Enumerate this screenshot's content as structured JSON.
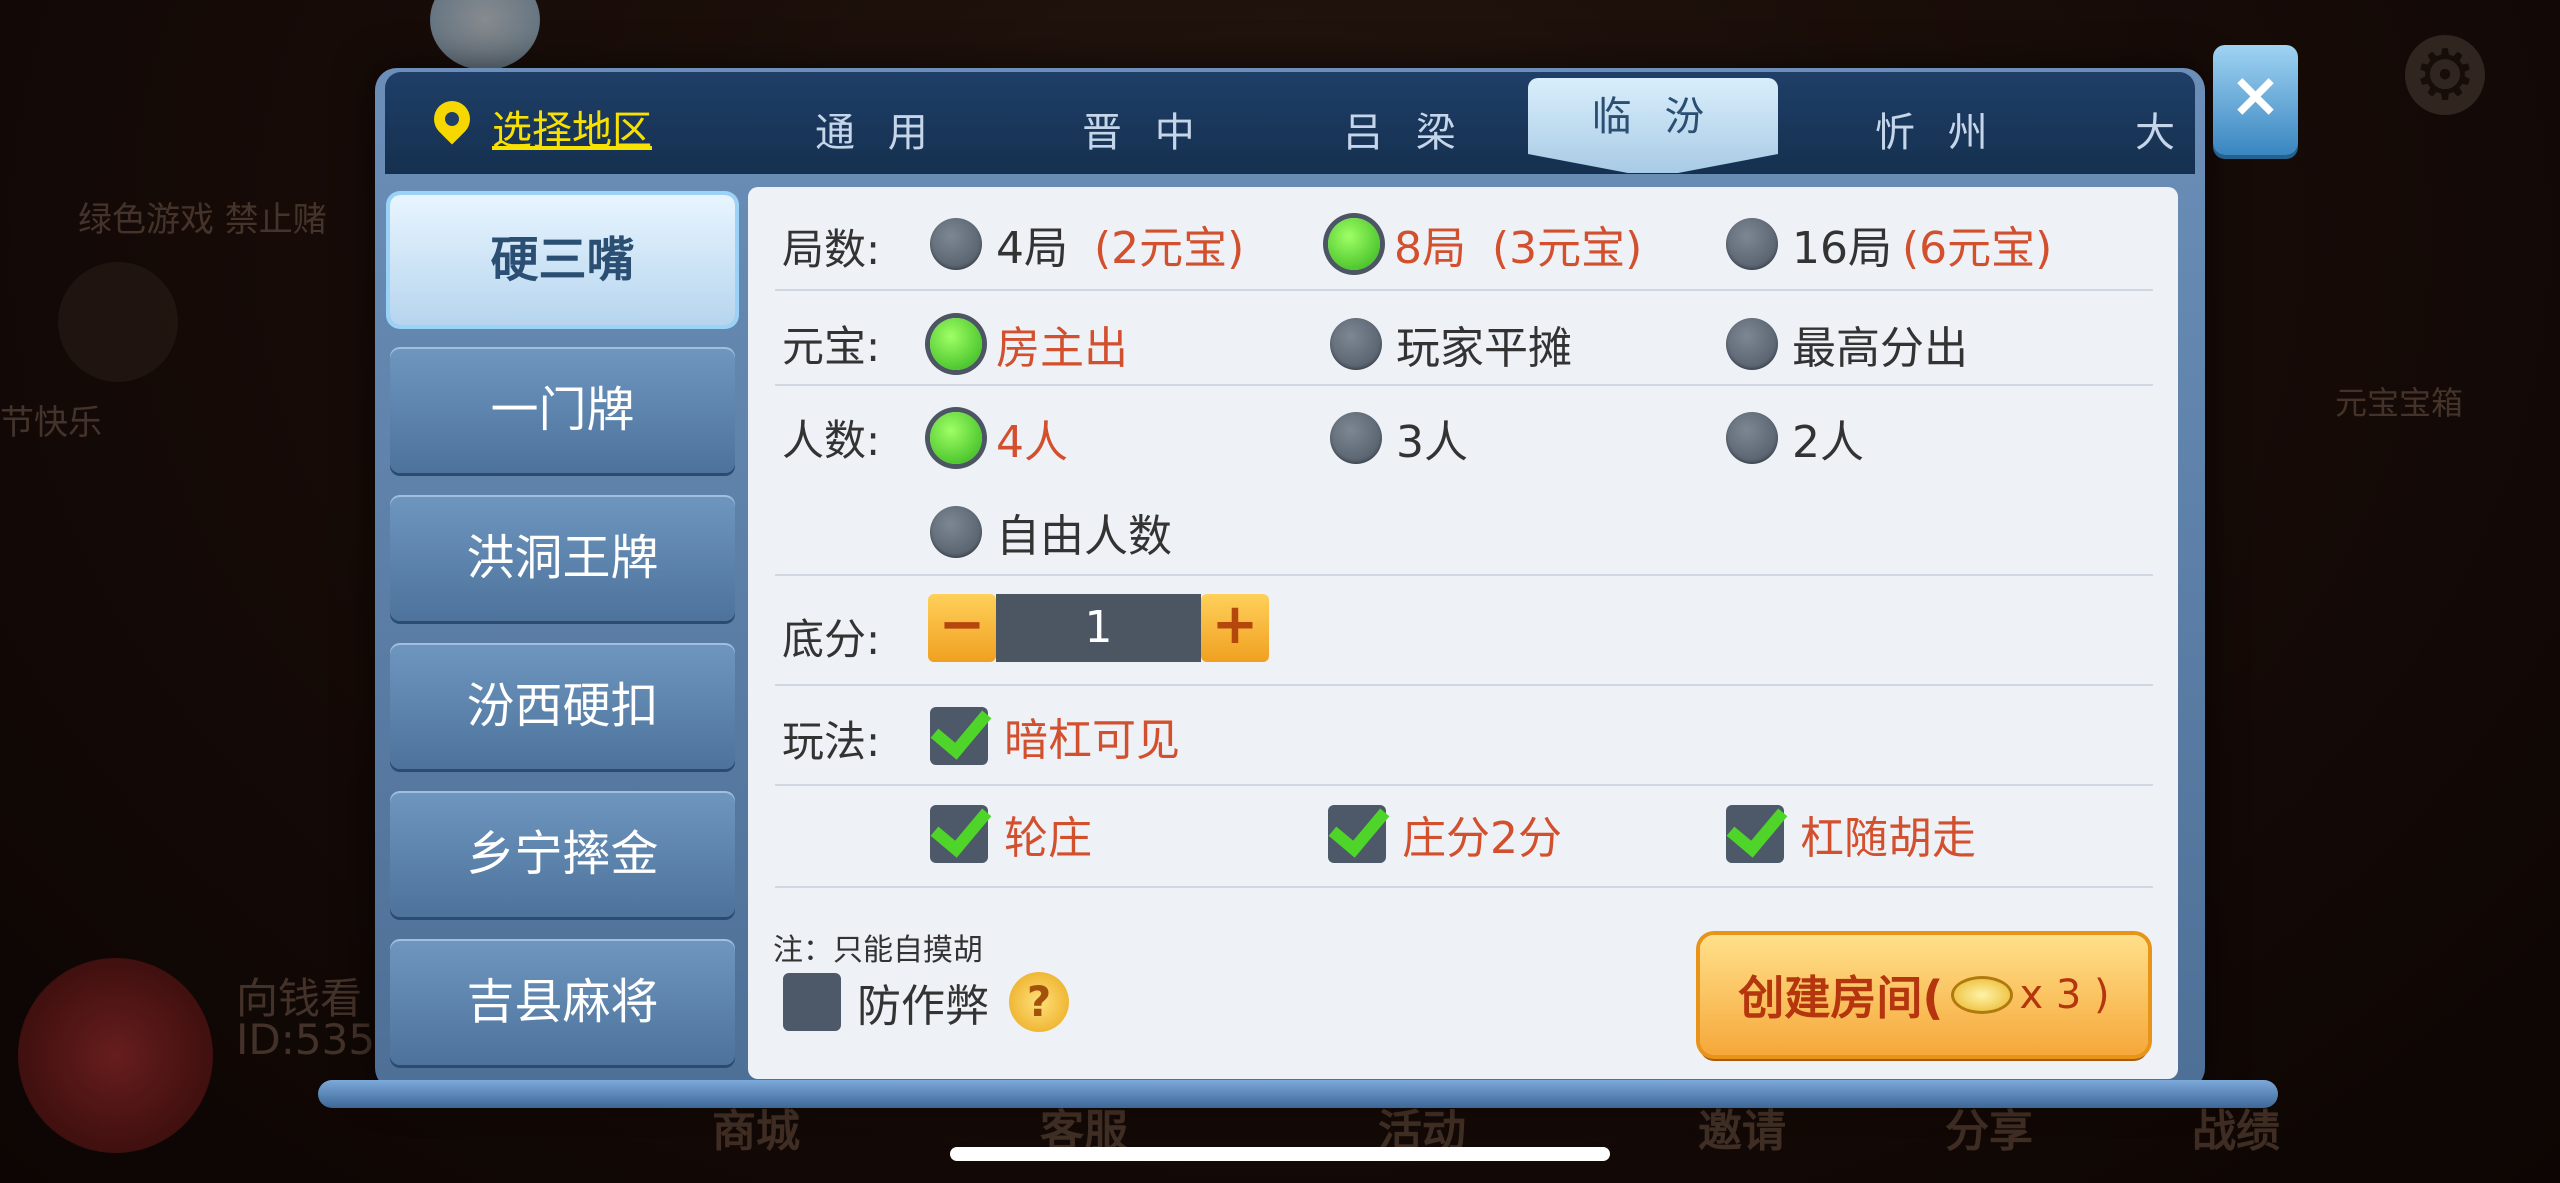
{
  "background": {
    "left_text": "绿色游戏 禁止赌",
    "greeting": "节快乐",
    "right_label": "元宝宝箱",
    "player_name": "向钱看",
    "player_id": "ID:535",
    "bottom_nav": [
      "商城",
      "客服",
      "活动",
      "邀请",
      "分享",
      "战绩"
    ]
  },
  "region": {
    "label": "选择地区"
  },
  "tabs": [
    "通 用",
    "晋 中",
    "吕 梁",
    "临 汾",
    "忻 州",
    "大"
  ],
  "active_tab": "临 汾",
  "close_label": "×",
  "sidebar": {
    "items": [
      "硬三嘴",
      "一门牌",
      "洪洞王牌",
      "汾西硬扣",
      "乡宁摔金",
      "吉县麻将"
    ],
    "active": "硬三嘴"
  },
  "settings": {
    "rounds": {
      "label": "局数:",
      "options": [
        {
          "text": "4局",
          "cost": "(2元宝)",
          "selected": false
        },
        {
          "text": "8局",
          "cost": "(3元宝)",
          "selected": true
        },
        {
          "text": "16局",
          "cost": "(6元宝)",
          "selected": false
        }
      ]
    },
    "payment": {
      "label": "元宝:",
      "options": [
        {
          "text": "房主出",
          "selected": true
        },
        {
          "text": "玩家平摊",
          "selected": false
        },
        {
          "text": "最高分出",
          "selected": false
        }
      ]
    },
    "players": {
      "label": "人数:",
      "options": [
        {
          "text": "4人",
          "selected": true
        },
        {
          "text": "3人",
          "selected": false
        },
        {
          "text": "2人",
          "selected": false
        },
        {
          "text": "自由人数",
          "selected": false
        }
      ]
    },
    "base_score": {
      "label": "底分:",
      "minus": "−",
      "value": "1",
      "plus": "+"
    },
    "rules": {
      "label": "玩法:",
      "options": [
        {
          "text": "暗杠可见",
          "checked": true
        },
        {
          "text": "轮庄",
          "checked": true
        },
        {
          "text": "庄分2分",
          "checked": true
        },
        {
          "text": "杠随胡走",
          "checked": true
        }
      ]
    },
    "note": "注：只能自摸胡",
    "anti_cheat": {
      "text": "防作弊",
      "checked": false,
      "help": "?"
    }
  },
  "create": {
    "label": "创建房间(",
    "multiplier": "x 3 )"
  },
  "colors": {
    "accent_red": "#d2502e",
    "region_yellow": "#f8e100",
    "radio_green": "#31b21b"
  }
}
